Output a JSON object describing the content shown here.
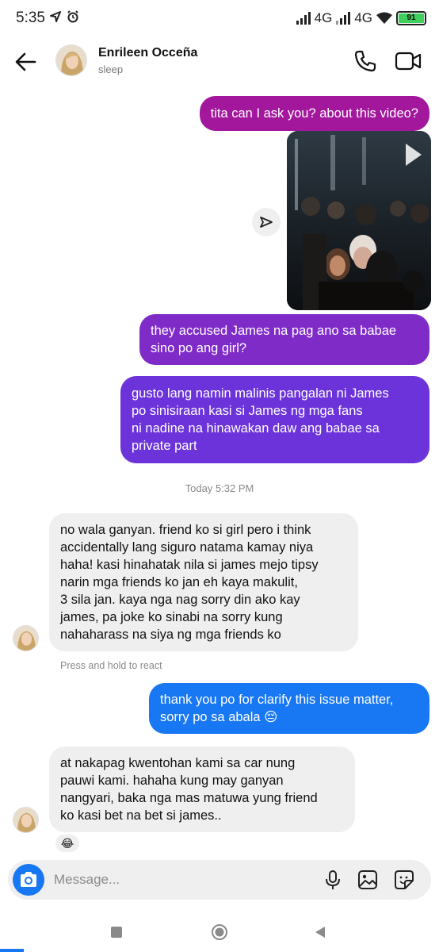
{
  "status_bar": {
    "time": "5:35",
    "network1": "4G",
    "network2": "4G",
    "battery": "91"
  },
  "header": {
    "contact_name": "Enrileen Occeña",
    "contact_status": "sleep"
  },
  "messages": [
    {
      "from": "me",
      "text": "tita can I ask you? about this video?"
    },
    {
      "from": "me",
      "type": "video"
    },
    {
      "from": "me",
      "text": "they accused James na pag ano sa babae\nsino po ang girl?"
    },
    {
      "from": "me",
      "text": "gusto lang namin malinis pangalan ni James\npo sinisiraan kasi si James ng mga fans\nni nadine na hinawakan daw ang babae sa\nprivate part"
    },
    {
      "from": "them",
      "text": "no wala ganyan. friend ko si girl pero i think\naccidentally lang siguro natama kamay niya\nhaha! kasi hinahatak nila si james mejo tipsy\nnarin mga friends ko jan eh kaya makulit,\n3 sila jan. kaya nga nag sorry din ako kay\njames, pa joke ko sinabi na sorry kung\nnahaharass na siya ng mga friends ko"
    },
    {
      "from": "me",
      "text": "thank you po for clarify this issue matter,\nsorry po sa abala 😔"
    },
    {
      "from": "them",
      "text": "at nakapag kwentohan kami sa car nung\npauwi kami. hahaha kung may ganyan\nnangyari, baka nga mas matuwa yung friend\nko kasi bet na bet si james..",
      "reaction": "😂"
    }
  ],
  "timestamp": "Today 5:32 PM",
  "react_hint": "Press and hold to react",
  "composer": {
    "placeholder": "Message..."
  },
  "colors": {
    "bubble_1": "#a2179c",
    "bubble_2": "#7f2bc8",
    "bubble_3": "#6b33d9",
    "bubble_4": "#1877f2",
    "incoming": "#efefef",
    "accent": "#1877f2"
  },
  "icons": [
    "back-arrow-icon",
    "phone-icon",
    "video-call-icon",
    "share-icon",
    "camera-icon",
    "microphone-icon",
    "gallery-icon",
    "sticker-icon",
    "play-icon"
  ]
}
